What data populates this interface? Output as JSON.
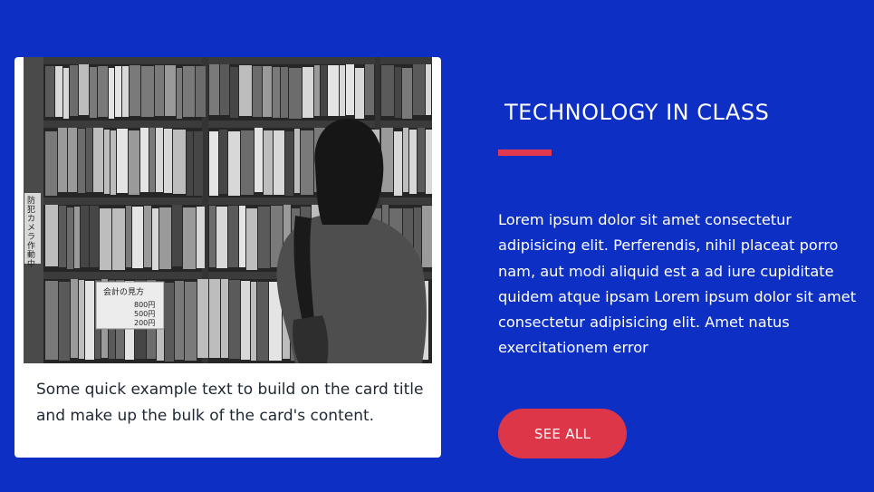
{
  "card": {
    "image_alt": "Person browsing a bookshelf",
    "text": "Some quick example text to build on the card title and make up the bulk of the card's content.",
    "image_sign": {
      "line1": "会計の見方",
      "prices": [
        "800円",
        "500円",
        "200円"
      ],
      "side_label": "防犯カメラ作動中"
    }
  },
  "section": {
    "title": "TECHNOLOGY IN CLASS",
    "description": "Lorem ipsum dolor sit amet consectetur adipisicing elit. Perferendis, nihil placeat porro nam, aut modi aliquid est a ad iure cupiditate quidem atque ipsam Lorem ipsum dolor sit amet consectetur adipisicing elit. Amet natus exercitationem error",
    "button_label": "SEE ALL"
  },
  "colors": {
    "background": "#0d2fc4",
    "accent": "#e0384e",
    "button": "#dc3648",
    "card_text": "#1e2733"
  }
}
